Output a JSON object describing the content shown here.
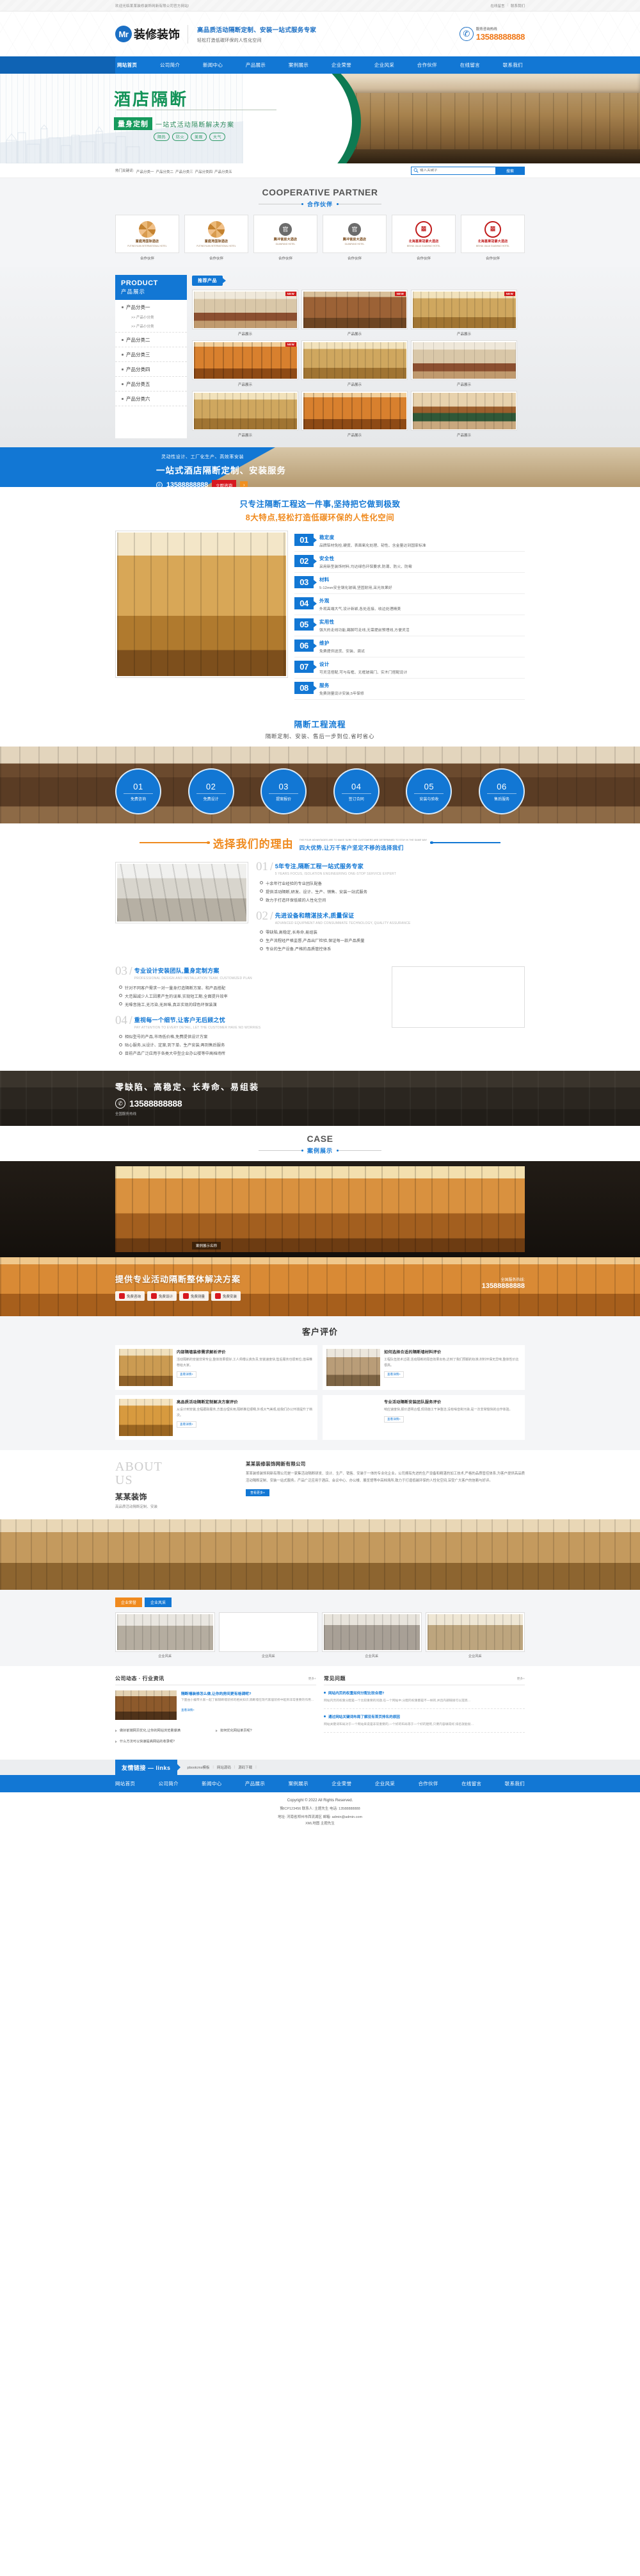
{
  "topbar": {
    "welcome": "欢迎光临某某装修装饰网新有限公司官方网站!",
    "link1": "在线留言",
    "sep": "|",
    "link2": "联系我们"
  },
  "header": {
    "logo_mark": "Mr",
    "logo_text": "装修装饰",
    "slogan_main": "高品质活动隔断定制、安装一站式服务专家",
    "slogan_sub": "轻松打造低碳环保的人性化空间",
    "tel_icon": "phone-icon",
    "tel_label": "服务咨询热线",
    "tel_number": "13588888888",
    "accent": "#1277d4",
    "tel_color": "#f07818"
  },
  "nav": {
    "items": [
      {
        "label": "网站首页",
        "active": true
      },
      {
        "label": "公司简介",
        "active": false
      },
      {
        "label": "新闻中心",
        "active": false
      },
      {
        "label": "产品展示",
        "active": false
      },
      {
        "label": "案例展示",
        "active": false
      },
      {
        "label": "企业荣誉",
        "active": false
      },
      {
        "label": "企业风采",
        "active": false
      },
      {
        "label": "合作伙伴",
        "active": false
      },
      {
        "label": "在线留言",
        "active": false
      },
      {
        "label": "联系我们",
        "active": false
      }
    ]
  },
  "hero": {
    "title": "酒店隔断",
    "tag": "量身定制",
    "desc": "一站式活动隔断解决方案",
    "pills": [
      "隔热",
      "防火",
      "美观",
      "大气"
    ],
    "dots": 3,
    "active_dot": 1
  },
  "search": {
    "kw_label": "热门关键词:",
    "keywords": [
      "产品分类一",
      "产品分类二",
      "产品分类三",
      "产品分类四",
      "产品分类五"
    ],
    "placeholder": "输入关键字",
    "value": "",
    "button": "搜索",
    "icon": "search-icon"
  },
  "partners": {
    "title_en": "COOPERATIVE PARTNER",
    "title_cn": "合作伙伴",
    "items": [
      {
        "name": "富庭苑国际酒店",
        "sub": "FUTINGYUAN INTERNATIONAL HOTEL",
        "style": "a",
        "caption": "合作伙伴"
      },
      {
        "name": "富庭苑国际酒店",
        "sub": "FUTINGYUAN INTERNATIONAL HOTEL",
        "style": "a",
        "caption": "合作伙伴"
      },
      {
        "name": "腾冲官房大酒店",
        "sub": "GUANFANG HOTEL",
        "style": "b",
        "caption": "合作伙伴"
      },
      {
        "name": "腾冲官房大酒店",
        "sub": "GUANFANG HOTEL",
        "style": "b",
        "caption": "合作伙伴"
      },
      {
        "name": "北海嘉莱冠豪大酒店",
        "sub": "BEIHAI JIALAI GUANHAO HOTEL",
        "style": "c",
        "caption": "合作伙伴"
      },
      {
        "name": "北海嘉莱冠豪大酒店",
        "sub": "BEIHAI JIALAI GUANHAO HOTEL",
        "style": "c",
        "caption": "合作伙伴"
      }
    ]
  },
  "product": {
    "sidebar_en": "PRODUCT",
    "sidebar_cn": "产品展示",
    "categories": [
      {
        "label": "产品分类一",
        "subs": [
          ">> 产品小分类",
          ">> 产品小分类"
        ]
      },
      {
        "label": "产品分类二",
        "subs": []
      },
      {
        "label": "产品分类三",
        "subs": []
      },
      {
        "label": "产品分类四",
        "subs": []
      },
      {
        "label": "产品分类五",
        "subs": []
      },
      {
        "label": "产品分类六",
        "subs": []
      }
    ],
    "tab": "推荐产品",
    "badge": "NEW",
    "items": [
      {
        "caption": "产品展示",
        "img": "img-hall"
      },
      {
        "caption": "产品展示",
        "img": "img-wood"
      },
      {
        "caption": "产品展示",
        "img": "img-gold2"
      },
      {
        "caption": "产品展示",
        "img": "img-orange"
      },
      {
        "caption": "产品展示",
        "img": "img-gold2"
      },
      {
        "caption": "产品展示",
        "img": "img-hall"
      },
      {
        "caption": "产品展示",
        "img": "img-gold2"
      },
      {
        "caption": "产品展示",
        "img": "img-orange"
      },
      {
        "caption": "产品展示",
        "img": "img-conf"
      }
    ]
  },
  "cta1": {
    "line1": "灵动性设计、工厂化生产、高效率安装",
    "line2": "一站式酒店隔断定制、安装服务",
    "phone_icon": "phone-icon",
    "tel": "13588888888",
    "button": "立即咨询",
    "arrow": "›"
  },
  "features": {
    "heading1": "只专注隔断工程这一件事,坚持把它做到极致",
    "heading2": "8大特点,轻松打造低碳环保的人性化空间",
    "items": [
      {
        "no": "01",
        "title": "稳定度",
        "desc": "品牌铝材免检,硬度、表面氧化处理、韧性、含金量达到国家标准"
      },
      {
        "no": "02",
        "title": "安全性",
        "desc": "采用新型装饰材料,均达绿色环保要求,防潮、防火、防霉"
      },
      {
        "no": "03",
        "title": "材料",
        "desc": "5-12mm安全钢化玻璃,坚固耐用,采光效果好"
      },
      {
        "no": "04",
        "title": "外观",
        "desc": "外观高端大气,设计新颖,各处连接、收边处理精美"
      },
      {
        "no": "05",
        "title": "实用性",
        "desc": "强大的走线功能,踢脚可走线,无需提前预埋线,方便灵活"
      },
      {
        "no": "06",
        "title": "维护",
        "desc": "免费提供送货、安装、调试"
      },
      {
        "no": "07",
        "title": "设计",
        "desc": "可灵活搭配,可与有框、无框玻璃门、实木门搭配设计"
      },
      {
        "no": "08",
        "title": "服务",
        "desc": "免费测量设计安装,5年保修"
      }
    ]
  },
  "process": {
    "title": "隔断工程流程",
    "subtitle": "隔断定制、安装、售后一步到位,省时省心",
    "steps": [
      {
        "no": "01",
        "label": "免费咨询"
      },
      {
        "no": "02",
        "label": "免费设计"
      },
      {
        "no": "03",
        "label": "提案报价"
      },
      {
        "no": "04",
        "label": "签订合同"
      },
      {
        "no": "05",
        "label": "安装与验收"
      },
      {
        "no": "06",
        "label": "售后服务"
      }
    ]
  },
  "why": {
    "title": "选择我们的理由",
    "sub_en": "THE FOUR ADVANTAGES ARE TO MAKE SURE THE CUSTOMERS ARE DETERMINED TO STAY IN THE SAME WAY",
    "sub_cn": "四大优势,让万千客户坚定不移的选择我们",
    "advantages": [
      {
        "no": "01",
        "title": "5年专注,隔断工程一站式服务专家",
        "en": "5 YEARS FOCUS, ISOLATION ENGINEERING ONE-STOP SERVICE EXPERT",
        "points": [
          "十余年行业经验的专业团队配备",
          "提供活动隔断,研发、设计、生产、销售、安装一站式服务",
          "致力于打造环保低碳的人性化空间"
        ]
      },
      {
        "no": "02",
        "title": "先进设备和精湛技术,质量保证",
        "en": "ADVANCED EQUIPMENT AND CONSUMMATE TECHNOLOGY, QUALITY ASSURANCE",
        "points": [
          "零缺陷,高稳定,长寿命,易组装",
          "生产流程经严格监督,产品出厂检验,保证每一款产品质量",
          "专业的生产设备,严格的品质管控体系"
        ]
      },
      {
        "no": "03",
        "title": "专业设计安装团队,量身定制方案",
        "en": "PROFESSIONAL DESIGN AND INSTALLATION TEAM, CUSTOMIZED PLAN",
        "points": [
          "针对不同客户需求一对一量身打造隔断方案、和产品搭配",
          "大范围减少人工因素产生的误差,实现短工期,全面提升效率",
          "无噪音施工,无污染,无异味,真正实现的绿色环保装潢"
        ]
      },
      {
        "no": "04",
        "title": "重视每一个细节,让客户无后顾之忧",
        "en": "PAY ATTENTION TO EVERY DETAIL, LET THE CUSTOMER HAVE NO WORRIES",
        "points": [
          "相似型号的产品,市场低价格,免费提供设计方案",
          "贴心服务,从设计、定案,到下单、生产安装;再到售后服务",
          "目前产品广泛应用于各类大中型企业办公楼等中高档场所"
        ]
      }
    ]
  },
  "cta2": {
    "title": "零缺陷、高稳定、长寿命、易组装",
    "phone_icon": "phone-icon",
    "tel": "13588888888",
    "sub": "全国服务热线"
  },
  "case": {
    "title_en": "CASE",
    "title_cn": "案例展示",
    "caption": "案例展示名称"
  },
  "cta3": {
    "title": "提供专业活动隔断整体解决方案",
    "hotline_label": "全国服务热线:",
    "tel": "13588888888",
    "buttons": [
      {
        "icon": "phone-icon",
        "label": "免费咨询"
      },
      {
        "icon": "doc-icon",
        "label": "免费设计"
      },
      {
        "icon": "truck-icon",
        "label": "免费测量"
      },
      {
        "icon": "shield-icon",
        "label": "免费安装"
      }
    ]
  },
  "reviews": {
    "title": "客户评价",
    "items": [
      {
        "title": "内部隔墙装修需求解析评价",
        "text": "活动隔断的安装非常专业,整体效果很好,工人师傅认真负责,安装速度快,售后服务也很到位,值得推荐给大家。",
        "more": "查看详情+",
        "img": "im-rev1"
      },
      {
        "title": "如何选择合适的隔断墙材料评价",
        "text": "工程队伍技术过硬,活动隔断的隔音效果出色,达到了我们预期的标准,材料环保无异味,整体性价比很高。",
        "more": "查看详情+",
        "img": "im-rev2"
      },
      {
        "title": "高品质活动隔断定制解决方案评价",
        "text": "从设计到安装,全程跟踪服务,方案合理实用,隔断推拉顺畅,外观大气美观,给我们办公环境提升了档次。",
        "more": "查看详情+",
        "img": "im-rev3"
      },
      {
        "title": "专业活动隔断安装团队服务评价",
        "text": "响应速度快,报价透明合理,现场施工干净整洁,没有噪音和污染,是一次非常愉快的合作体验。",
        "more": "查看详情+",
        "img": "im-rev4"
      }
    ]
  },
  "about": {
    "en_line1": "ABOUT",
    "en_line2": "US",
    "name": "某某装饰",
    "sub": "高品质活动隔断定制、安装",
    "heading": "某某装修装饰网新有限公司",
    "paragraph": "某某装修装饰网新有限公司是一家集活动隔断研发、设计、生产、销售、安装于一体的专业化企业。公司拥有先进的生产设备和精湛的加工技术,严格的品质管控体系,为客户提供高品质活动隔断定制、安装一站式服务。产品广泛应用于酒店、会议中心、办公楼、展览馆等中高档场所,致力于打造低碳环保的人性化空间,深受广大客户的信赖与好评。",
    "more": "查看更多+"
  },
  "factory": {
    "tabs": [
      {
        "label": "企业荣誉",
        "style": "o"
      },
      {
        "label": "企业风采",
        "style": "b"
      }
    ],
    "cells": [
      {
        "caption": "企业风采",
        "img": "fc1"
      },
      {
        "caption": "企业风采",
        "img": "fc2"
      },
      {
        "caption": "企业风采",
        "img": "fc3"
      },
      {
        "caption": "企业风采",
        "img": "fc4"
      }
    ]
  },
  "news": {
    "left": {
      "title": "公司动态 · 行业资讯",
      "more": "更多+",
      "feature": {
        "heading": "隔断墙装修怎么做,让你的房间更有格调呢?",
        "text": "下面由小编带大家一起了解隔断墙装修的相关知识,隔断墙在现代家居装修中起到非常重要的作用…",
        "more": "查看详情+"
      },
      "items": [
        "做好前端网页优化,让你的网站浏览量爆满",
        "如何优化网站单页呢?",
        "什么方法可以快速提高网站的收录呢?"
      ]
    },
    "right": {
      "title": "常见问题",
      "more": "更多+",
      "faqs": [
        {
          "q": "网站内页的权重如何分配比较合理?",
          "a": "网站内页的权重分配是一个比较重要的问题,在一个网站中,分配的权重都是不一样的,并且内部链接可以提高…"
        },
        {
          "q": "通过网站关键词布局了解没有首页排名的原因",
          "a": "网站关键词布局对于一个网站来说是非常重要的,一个好的布局等于一个好的建筑,只要内容填得好,排名就能很…"
        }
      ]
    }
  },
  "links": {
    "badge": "友情链接 — links",
    "items": [
      "pbootcms模板",
      "网站源码",
      "源码下载"
    ],
    "sep": "|"
  },
  "footer": {
    "nav": [
      "网站首页",
      "公司简介",
      "新闻中心",
      "产品展示",
      "案例展示",
      "企业荣誉",
      "企业风采",
      "合作伙伴",
      "在线留言",
      "联系我们"
    ],
    "copyright": "Copyright © 2022 All Rights Reserved.",
    "line2": "豫ICP123456 联系人: 主题先生 电话: 13588888888",
    "line3": "地址: 河南省郑州市西流湖区   邮箱: admin@admin.com",
    "line4": "XML地图 主题先生"
  }
}
